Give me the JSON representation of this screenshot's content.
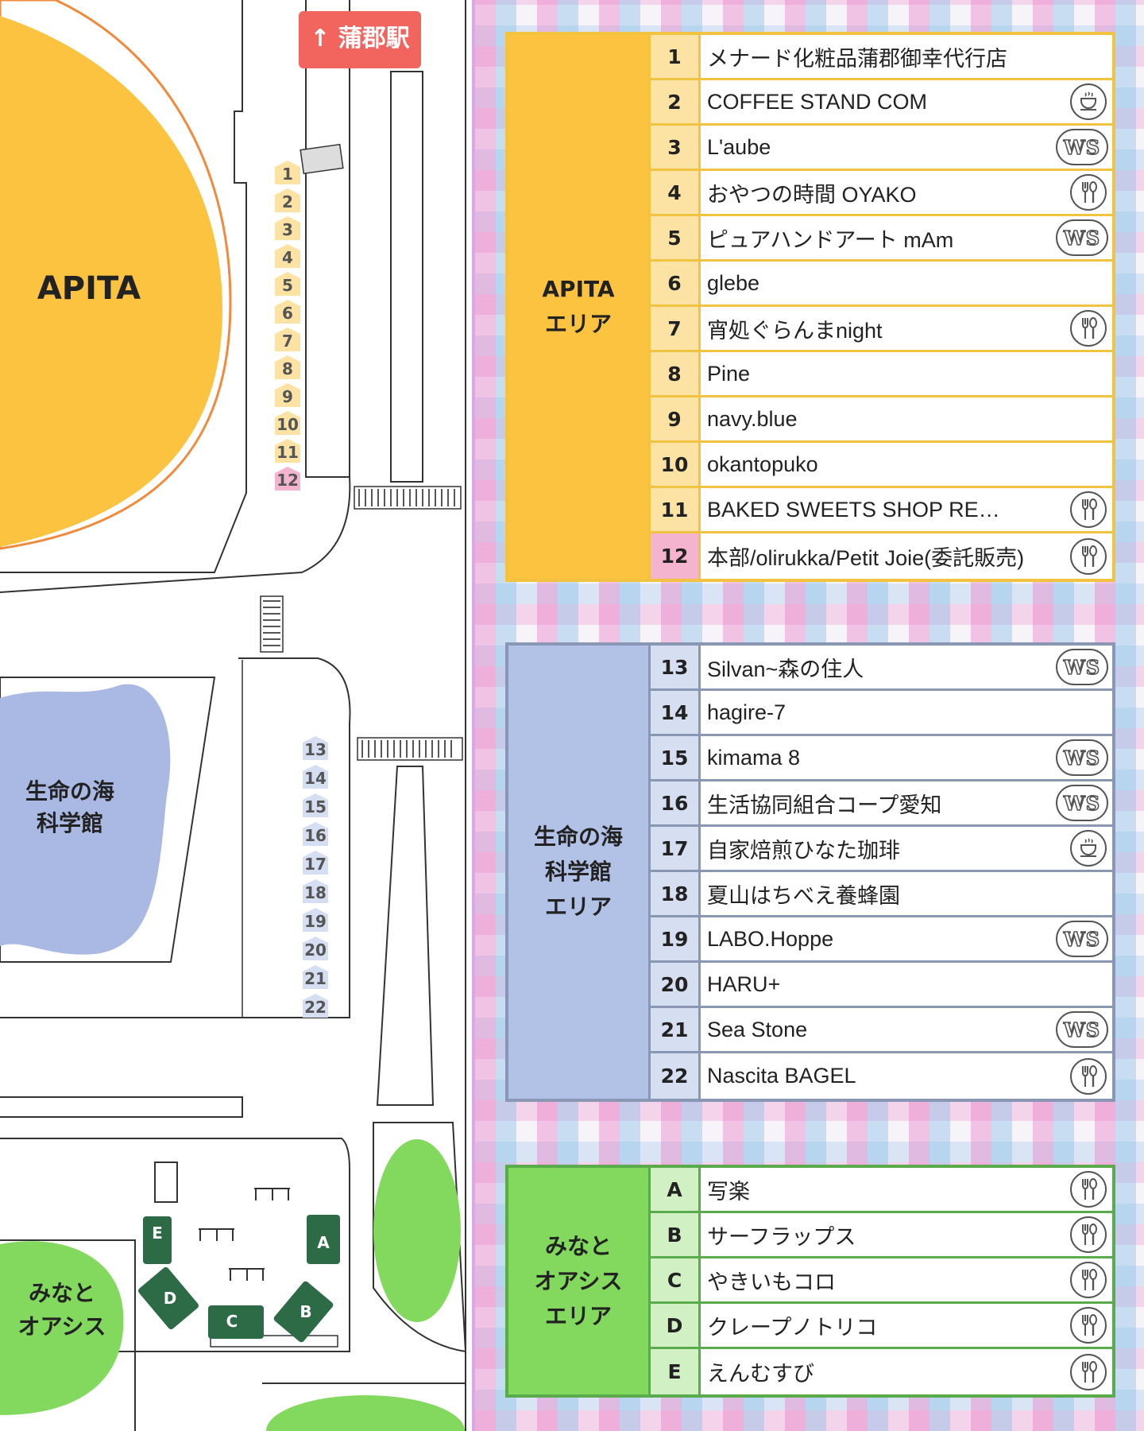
{
  "map": {
    "station_sign": "↑ 蒲郡駅",
    "apita_label": "APITA",
    "science_label_1": "生命の海",
    "science_label_2": "科学館",
    "oasis_label_1": "みなと",
    "oasis_label_2": "オアシス",
    "apita_markers": [
      "1",
      "2",
      "3",
      "4",
      "5",
      "6",
      "7",
      "8",
      "9",
      "10",
      "11",
      "12"
    ],
    "sea_markers": [
      "13",
      "14",
      "15",
      "16",
      "17",
      "18",
      "19",
      "20",
      "21",
      "22"
    ],
    "trucks": [
      "A",
      "B",
      "C",
      "D",
      "E"
    ],
    "colors": {
      "apita": "#fbc33f",
      "science": "#a9b9e3",
      "oasis": "#83d95e",
      "sign": "#f2645e",
      "truck": "#2d6a46",
      "apita_marker": "#fce2a3",
      "pink_marker": "#f4b3cf",
      "sea_marker": "#d6def1"
    }
  },
  "legend_icons": {
    "ws": "WS",
    "cafe": "coffee-cup-icon",
    "food": "fork-spoon-icon"
  },
  "apita_area": {
    "title": "APITA\nエリア",
    "shops": [
      {
        "no": "1",
        "name": "メナード化粧品蒲郡御幸代行店",
        "icon": ""
      },
      {
        "no": "2",
        "name": "COFFEE STAND COM",
        "icon": "cafe"
      },
      {
        "no": "3",
        "name": "L'aube",
        "icon": "ws"
      },
      {
        "no": "4",
        "name": "おやつの時間 OYAKO",
        "icon": "food"
      },
      {
        "no": "5",
        "name": "ピュアハンドアート mAm",
        "icon": "ws"
      },
      {
        "no": "6",
        "name": "glebe",
        "icon": ""
      },
      {
        "no": "7",
        "name": "宵処ぐらんまnight",
        "icon": "food"
      },
      {
        "no": "8",
        "name": "Pine",
        "icon": ""
      },
      {
        "no": "9",
        "name": "navy.blue",
        "icon": ""
      },
      {
        "no": "10",
        "name": "okantopuko",
        "icon": ""
      },
      {
        "no": "11",
        "name": "BAKED SWEETS SHOP RE…",
        "icon": "food"
      },
      {
        "no": "12",
        "name": "本部/olirukka/Petit Joie(委託販売)",
        "icon": "food"
      }
    ]
  },
  "sea_area": {
    "title": "生命の海\n科学館\nエリア",
    "shops": [
      {
        "no": "13",
        "name": "Silvan~森の住人",
        "icon": "ws"
      },
      {
        "no": "14",
        "name": "hagire-7",
        "icon": ""
      },
      {
        "no": "15",
        "name": "kimama 8",
        "icon": "ws"
      },
      {
        "no": "16",
        "name": "生活協同組合コープ愛知",
        "icon": "ws"
      },
      {
        "no": "17",
        "name": "自家焙煎ひなた珈琲",
        "icon": "cafe"
      },
      {
        "no": "18",
        "name": "夏山はちべえ養蜂園",
        "icon": ""
      },
      {
        "no": "19",
        "name": "LABO.Hoppe",
        "icon": "ws"
      },
      {
        "no": "20",
        "name": "HARU+",
        "icon": ""
      },
      {
        "no": "21",
        "name": "Sea Stone",
        "icon": "ws"
      },
      {
        "no": "22",
        "name": "Nascita BAGEL",
        "icon": "food"
      }
    ]
  },
  "oasis_area": {
    "title": "みなと\nオアシス\nエリア",
    "shops": [
      {
        "no": "A",
        "name": "写楽",
        "icon": "food"
      },
      {
        "no": "B",
        "name": "サーフラップス",
        "icon": "food"
      },
      {
        "no": "C",
        "name": "やきいもコロ",
        "icon": "food"
      },
      {
        "no": "D",
        "name": "クレープノトリコ",
        "icon": "food"
      },
      {
        "no": "E",
        "name": "えんむすび",
        "icon": "food"
      }
    ]
  }
}
